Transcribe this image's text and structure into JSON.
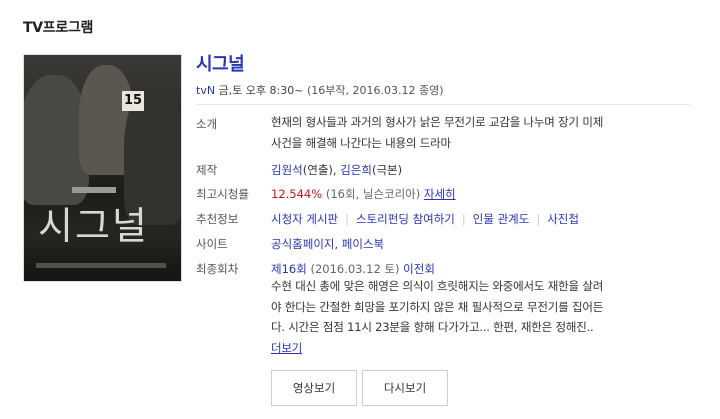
{
  "section_title": "TV프로그램",
  "program": {
    "title": "시그널",
    "channel": "tvN",
    "schedule": "금,토 오후 8:30~",
    "meta": "(16부작,  2016.03.12 종영)"
  },
  "poster": {
    "title_text": "시그널",
    "sign_number": "15"
  },
  "info": {
    "synopsis_label": "소개",
    "synopsis_line1": "현재의 형사들과 과거의 형사가 낡은 무전기로 교감을 나누며 장기 미제",
    "synopsis_line2": "사건을 해결해 나간다는 내용의 드라마",
    "production_label": "제작",
    "director": "김원석",
    "director_role": "(연출),",
    "writer": "김은희",
    "writer_role": "(극본)",
    "ratings_label": "최고시청률",
    "ratings_value": "12.544%",
    "ratings_detail": "(16회, 닐슨코리아)",
    "ratings_more": "자세히",
    "recommend_label": "추천정보",
    "recommend_links": [
      "시청자 게시판",
      "스토리펀딩 참여하기",
      "인물 관계도",
      "사진첩"
    ],
    "site_label": "사이트",
    "site_links": "공식홈페이지, 페이스북",
    "last_label": "최종회차",
    "last_episode": "제16회",
    "last_date": "(2016.03.12 토)",
    "last_title": "이전회",
    "last_line1": "수현 대신 총에 맞은 해영은 의식이 흐릿해지는 와중에서도 재한을 살려",
    "last_line2": "야 한다는 간절한 희망을 포기하지 않은 채 필사적으로 무전기를 집어든",
    "last_line3": "다. 시간은 점점 11시 23분을 향해 다가가고... 한편, 재한은 정해진..",
    "more_link": "더보기"
  },
  "buttons": {
    "watch": "영상보기",
    "replay": "다시보기"
  }
}
